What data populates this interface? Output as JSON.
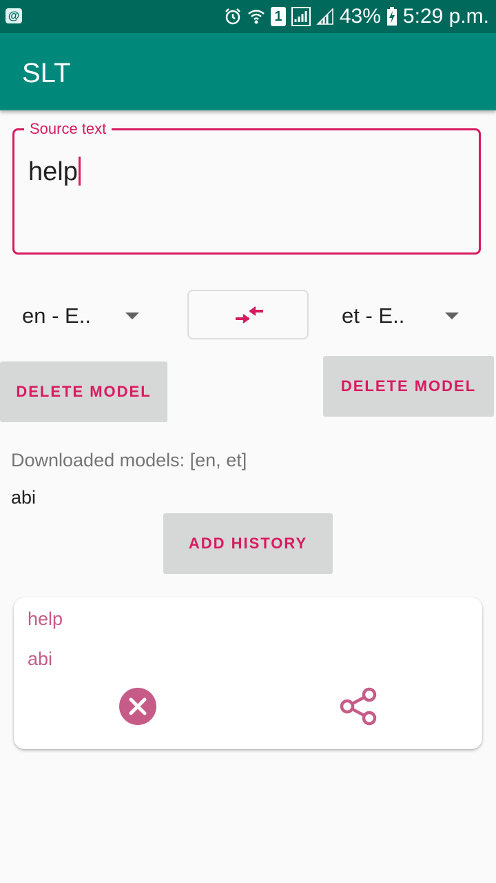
{
  "status_bar": {
    "notification_icon": "at-sign-icon",
    "sim_slot": "1",
    "battery_percent": "43%",
    "time": "5:29 p.m."
  },
  "app_bar": {
    "title": "SLT"
  },
  "source_field": {
    "label": "Source text",
    "value": "help"
  },
  "languages": {
    "source_selected": "en - E..",
    "target_selected": "et - E..",
    "swap_icon": "swap-arrows-icon"
  },
  "buttons": {
    "delete_source_model": "DELETE MODEL",
    "delete_target_model": "DELETE MODEL",
    "add_history": "ADD HISTORY"
  },
  "downloaded_models_text": "Downloaded models: [en, et]",
  "translation_output": "abi",
  "history": [
    {
      "source": "help",
      "translation": "abi"
    }
  ],
  "colors": {
    "status_bar": "#00695c",
    "app_bar": "#00897b",
    "accent": "#d81b60",
    "history_text": "#c75b87",
    "button_bg": "#d6d7d7"
  }
}
